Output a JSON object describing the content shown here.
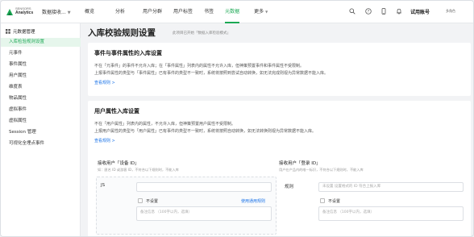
{
  "topbar": {
    "brand_line1": "SENSORS",
    "brand_line2": "Analytics",
    "project": "数据接收...",
    "nav": [
      {
        "label": "概览",
        "active": false
      },
      {
        "label": "分析",
        "active": false
      },
      {
        "label": "用户分群",
        "active": false
      },
      {
        "label": "用户标签",
        "active": false
      },
      {
        "label": "书签",
        "active": false
      },
      {
        "label": "元数据",
        "active": true
      },
      {
        "label": "更多",
        "active": false
      }
    ],
    "user_name": "试用账号",
    "user_sub": "多角色"
  },
  "sidebar": {
    "header": "元数据管理",
    "items": [
      {
        "label": "入库检验规则设置",
        "active": true
      },
      {
        "label": "元事件",
        "active": false
      },
      {
        "label": "事件属性",
        "active": false
      },
      {
        "label": "用户属性",
        "active": false
      },
      {
        "label": "维度表",
        "active": false
      },
      {
        "label": "物品属性",
        "active": false
      },
      {
        "label": "虚拟事件",
        "active": false
      },
      {
        "label": "虚拟属性",
        "active": false
      },
      {
        "label": "Session 管理",
        "active": false
      },
      {
        "label": "可视化全埋点事件",
        "active": false
      }
    ]
  },
  "page": {
    "title": "入库校验规则设置",
    "subtitle": "此项目已开始「数据入库检验模式」"
  },
  "card1": {
    "title": "事件与事件属性的入库设置",
    "line1": "不在「元事件」的事件不允许入库；在「事件属性」列表内的属性不允许入库，但神策预置事件和事件属性不受限制。",
    "line2": "上报事件属性的类型与「事件属性」已有事件的类型不一致时，系统将按照到尝试自动转换，如无法完成则视为异常数据不能入库。",
    "link": "查看规则 >"
  },
  "card2": {
    "title": "用户属性入库设置",
    "line1": "不在「用户属性」列表内的属性，不允许入库，但神策预置用户属性不受限制。",
    "line2": "上报用户属性的类型与「用户属性」已有事件的类型不一致时，系统将按照自动转换，如无法转换则视为异常数据不能入库。",
    "link": "查看规则 >",
    "left_col": {
      "title": "接收用户「设备 ID」",
      "desc": "如：匿名 ID 或游客 ID，不符合以下规则时，不能入库",
      "row_label": "JS",
      "input_placeholder": "",
      "checkbox_label": "不设置",
      "rule_link": "使用通用规则",
      "textarea_placeholder": "备注信息 （100字以内，选填）"
    },
    "right_col": {
      "title": "接收用户「登录 ID」",
      "desc": "用户在产品内的唯一标识，不符合以下规则时，不能入库",
      "row_label": "规则",
      "input_placeholder": "未设置 设置格式的 ID 符合上报入库",
      "checkbox_label": "不设置",
      "textarea_placeholder": "备注信息 （100字以内，选填）"
    }
  },
  "colors": {
    "accent": "#1ba854",
    "link": "#1a73e8",
    "sidebar_active_bg": "#e6f6ec"
  }
}
